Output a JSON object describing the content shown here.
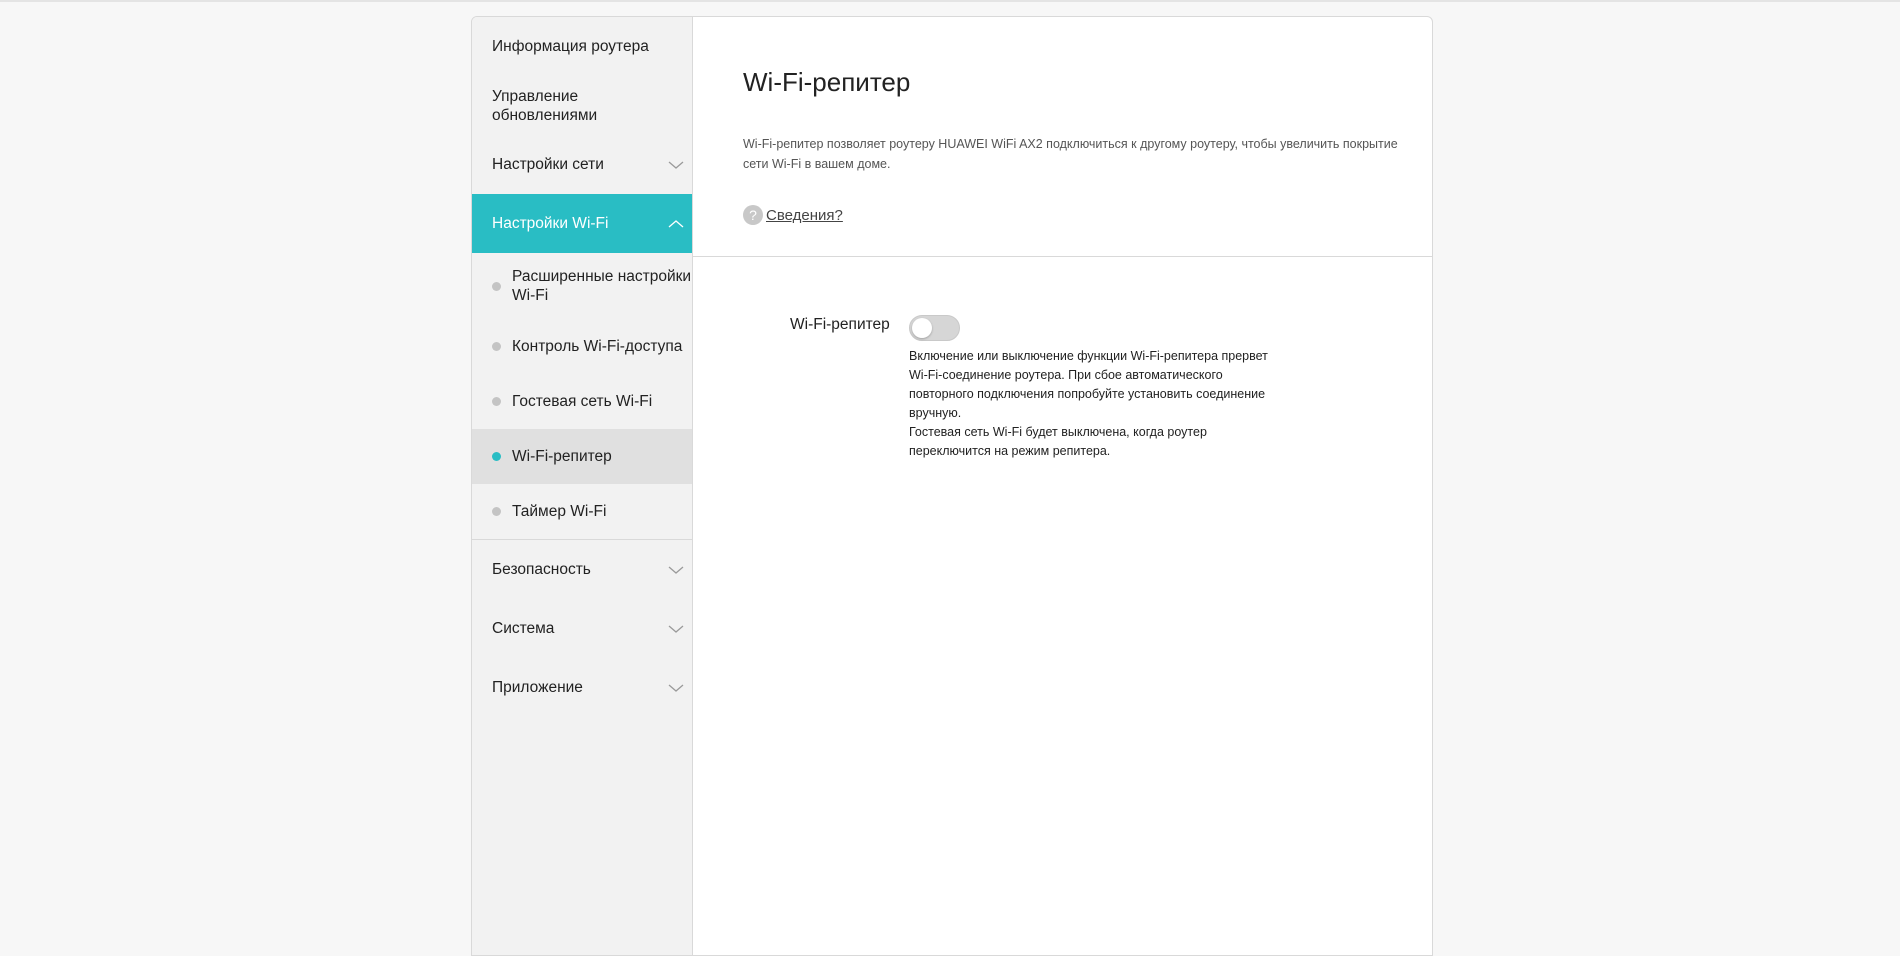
{
  "sidebar": {
    "router_info": "Информация роутера",
    "update_mgmt": "Управление обновлениями",
    "network_settings": "Настройки сети",
    "wifi_settings": "Настройки Wi-Fi",
    "wifi_sub": [
      {
        "label": "Расширенные настройки Wi-Fi"
      },
      {
        "label": "Контроль Wi-Fi-доступа"
      },
      {
        "label": "Гостевая сеть Wi-Fi"
      },
      {
        "label": "Wi-Fi-репитер"
      },
      {
        "label": "Таймер Wi-Fi"
      }
    ],
    "security": "Безопасность",
    "system": "Система",
    "apps": "Приложение"
  },
  "main": {
    "title": "Wi-Fi-репитер",
    "description": "Wi-Fi-репитер позволяет роутеру HUAWEI WiFi AX2 подключиться к другому роутеру, чтобы увеличить покрытие сети Wi-Fi в вашем доме.",
    "help_icon": "?",
    "help_link": "Сведения?",
    "repeater_label": "Wi-Fi-репитер",
    "repeater_enabled": false,
    "note_line1": "Включение или выключение функции Wi-Fi-репитера прервет Wi-Fi-соединение роутера. При сбое автоматического повторного подключения попробуйте установить соединение вручную.",
    "note_line2": "Гостевая сеть Wi-Fi будет выключена, когда роутер переключится на режим репитера."
  },
  "colors": {
    "accent": "#29bdc4",
    "sidebar_bg": "#f2f2f2",
    "selected_bg": "#e0e0e0",
    "page_bg": "#f7f7f7"
  }
}
